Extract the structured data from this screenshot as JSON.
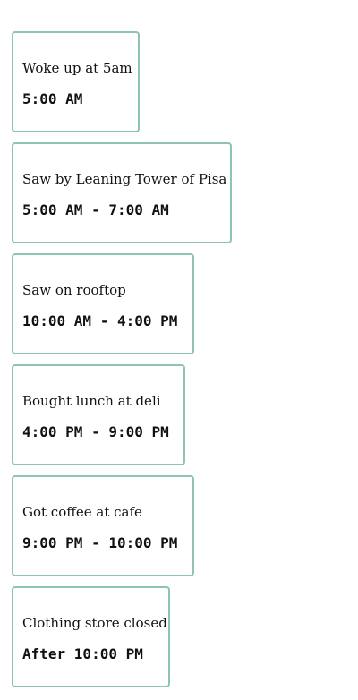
{
  "events": [
    {
      "title": "Woke up at 5am",
      "time": "5:00 AM"
    },
    {
      "title": "Saw by Leaning Tower of Pisa",
      "time": "5:00 AM - 7:00 AM"
    },
    {
      "title": "Saw on rooftop",
      "time": "10:00 AM - 4:00 PM"
    },
    {
      "title": "Bought lunch at deli",
      "time": "4:00 PM - 9:00 PM"
    },
    {
      "title": "Got coffee at cafe",
      "time": "9:00 PM - 10:00 PM"
    },
    {
      "title": "Clothing store closed",
      "time": "After 10:00 PM"
    }
  ],
  "colors": {
    "card_border": "#8fc5b0",
    "text": "#111111",
    "background": "#ffffff"
  }
}
